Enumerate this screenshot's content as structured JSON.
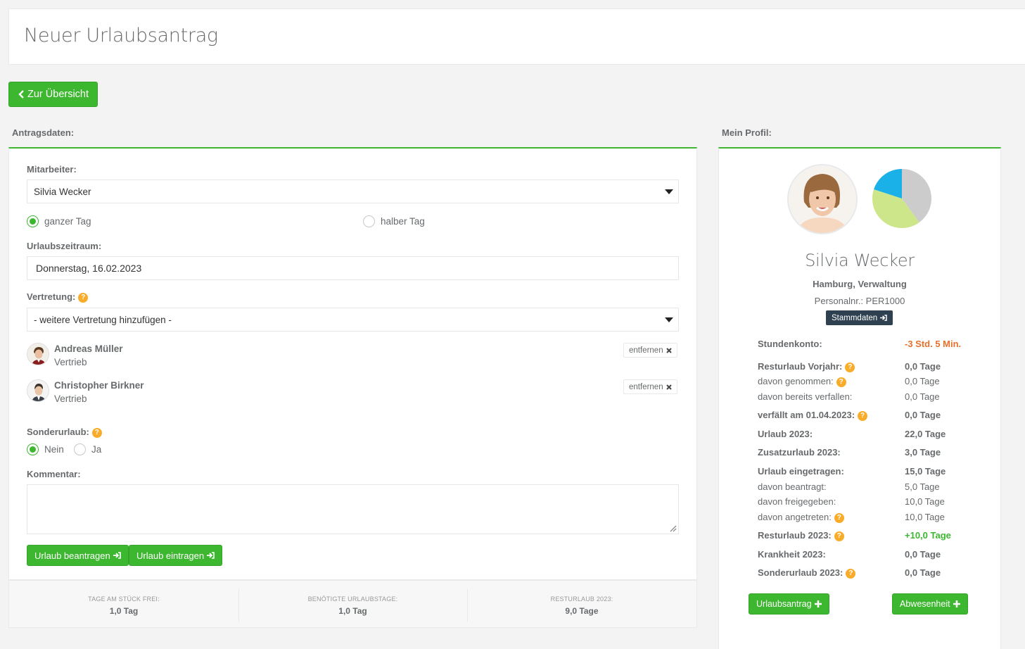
{
  "page": {
    "title": "Neuer Urlaubsantrag"
  },
  "nav": {
    "back_label": "Zur Übersicht"
  },
  "form": {
    "section_label": "Antragsdaten:",
    "employee_label": "Mitarbeiter:",
    "employee_value": "Silvia Wecker",
    "day_type": {
      "full_label": "ganzer Tag",
      "half_label": "halber Tag",
      "selected": "full"
    },
    "period_label": "Urlaubszeitraum:",
    "period_value": "Donnerstag, 16.02.2023",
    "substitute_label": "Vertretung:",
    "substitute_select": "- weitere Vertretung hinzufügen -",
    "substitutes": [
      {
        "name": "Andreas Müller",
        "dept": "Vertrieb",
        "remove_label": "entfernen"
      },
      {
        "name": "Christopher Birkner",
        "dept": "Vertrieb",
        "remove_label": "entfernen"
      }
    ],
    "special_label": "Sonderurlaub:",
    "special_no": "Nein",
    "special_yes": "Ja",
    "special_selected": "no",
    "comment_label": "Kommentar:",
    "comment_value": "",
    "submit_request_label": "Urlaub beantragen",
    "submit_enter_label": "Urlaub eintragen"
  },
  "stats": [
    {
      "label": "Tage am Stück frei:",
      "value": "1,0 Tag"
    },
    {
      "label": "Benötigte Urlaubstage:",
      "value": "1,0 Tag"
    },
    {
      "label": "Resturlaub 2023:",
      "value": "9,0 Tage"
    }
  ],
  "profile": {
    "section_label": "Mein Profil:",
    "name": "Silvia Wecker",
    "location": "Hamburg, Verwaltung",
    "personnel_nr": "Personalnr.: PER1000",
    "master_data_label": "Stammdaten",
    "pie": {
      "slices": [
        {
          "color": "#cccccc",
          "fraction": 0.4
        },
        {
          "color": "#cde68a",
          "fraction": 0.4
        },
        {
          "color": "#1ab0e8",
          "fraction": 0.2
        }
      ]
    },
    "rows": [
      {
        "key": "Stundenkonto:",
        "value": "-3 Std. 5 Min."
      },
      {
        "key": "Resturlaub Vorjahr:",
        "value": "0,0 Tage"
      },
      {
        "key": "davon genommen:",
        "value": "0,0 Tage"
      },
      {
        "key": "davon bereits verfallen:",
        "value": "0,0 Tage"
      },
      {
        "key": "verfällt am 01.04.2023:",
        "value": "0,0 Tage"
      },
      {
        "key": "Urlaub 2023:",
        "value": "22,0 Tage"
      },
      {
        "key": "Zusatzurlaub 2023:",
        "value": "3,0 Tage"
      },
      {
        "key": "Urlaub eingetragen:",
        "value": "15,0 Tage"
      },
      {
        "key": "davon beantragt:",
        "value": "5,0 Tage"
      },
      {
        "key": "davon freigegeben:",
        "value": "10,0 Tage"
      },
      {
        "key": "davon angetreten:",
        "value": "10,0 Tage"
      },
      {
        "key": "Resturlaub 2023:",
        "value": "+10,0 Tage"
      },
      {
        "key": "Krankheit 2023:",
        "value": "0,0 Tage"
      },
      {
        "key": "Sonderurlaub 2023:",
        "value": "0,0 Tage"
      }
    ],
    "vacation_btn": "Urlaubsantrag",
    "absence_btn": "Abwesenheit"
  }
}
